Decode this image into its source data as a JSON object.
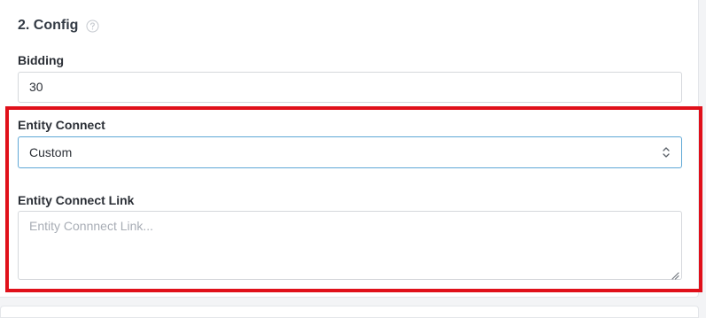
{
  "section": {
    "title": "2. Config",
    "help_icon": "question-circle-icon"
  },
  "bidding": {
    "label": "Bidding",
    "value": "30"
  },
  "entity_connect": {
    "label": "Entity Connect",
    "selected": "Custom",
    "chevron_icon": "updown-chevron-icon"
  },
  "entity_connect_link": {
    "label": "Entity Connect Link",
    "placeholder": "Entity Connnect Link...",
    "value": ""
  },
  "colors": {
    "highlight": "#e0101a",
    "focus_border": "#5fa8d6"
  }
}
